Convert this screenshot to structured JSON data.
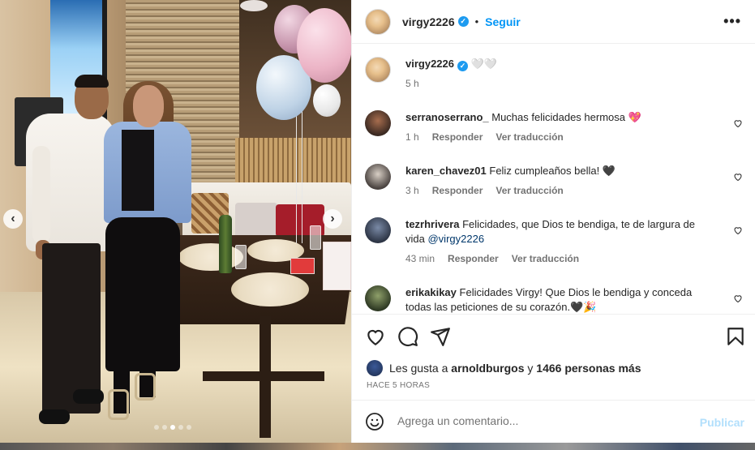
{
  "header": {
    "username": "virgy2226",
    "separator": "•",
    "follow_label": "Seguir",
    "more_label": "•••"
  },
  "caption": {
    "username": "virgy2226",
    "text": "🤍🤍",
    "time": "5 h"
  },
  "comments": [
    {
      "username": "serranoserrano_",
      "text": "Muchas felicidades hermosa 💖",
      "time": "1 h",
      "reply_label": "Responder",
      "translate_label": "Ver traducción"
    },
    {
      "username": "karen_chavez01",
      "text": "Feliz cumpleaños bella! 🖤",
      "time": "3 h",
      "reply_label": "Responder",
      "translate_label": "Ver traducción"
    },
    {
      "username": "tezrhrivera",
      "text": "Felicidades, que Dios te bendiga, te de largura de vida",
      "mention": "@virgy2226",
      "time": "43 min",
      "reply_label": "Responder",
      "translate_label": "Ver traducción"
    },
    {
      "username": "erikakikay",
      "text": "Felicidades Virgy! Que Dios le bendiga y conceda todas las peticiones de su corazón.🖤🎉"
    }
  ],
  "likes": {
    "prefix": "Les gusta a",
    "user": "arnoldburgos",
    "connector": "y",
    "others": "1466 personas más"
  },
  "time_ago": "HACE 5 HORAS",
  "add_comment": {
    "placeholder": "Agrega un comentario...",
    "publish_label": "Publicar"
  },
  "carousel": {
    "total": 5,
    "active": 2
  },
  "colors": {
    "link_blue": "#0095f6",
    "verified": "#1d9bf0",
    "publish_disabled": "#b2dffc",
    "muted": "#737373",
    "text": "#262626",
    "mention": "#00376b"
  },
  "icons": [
    "more-icon",
    "verified-icon",
    "heart-icon",
    "comment-icon",
    "share-icon",
    "bookmark-icon",
    "emoji-icon",
    "chevron-left-icon",
    "chevron-right-icon"
  ]
}
